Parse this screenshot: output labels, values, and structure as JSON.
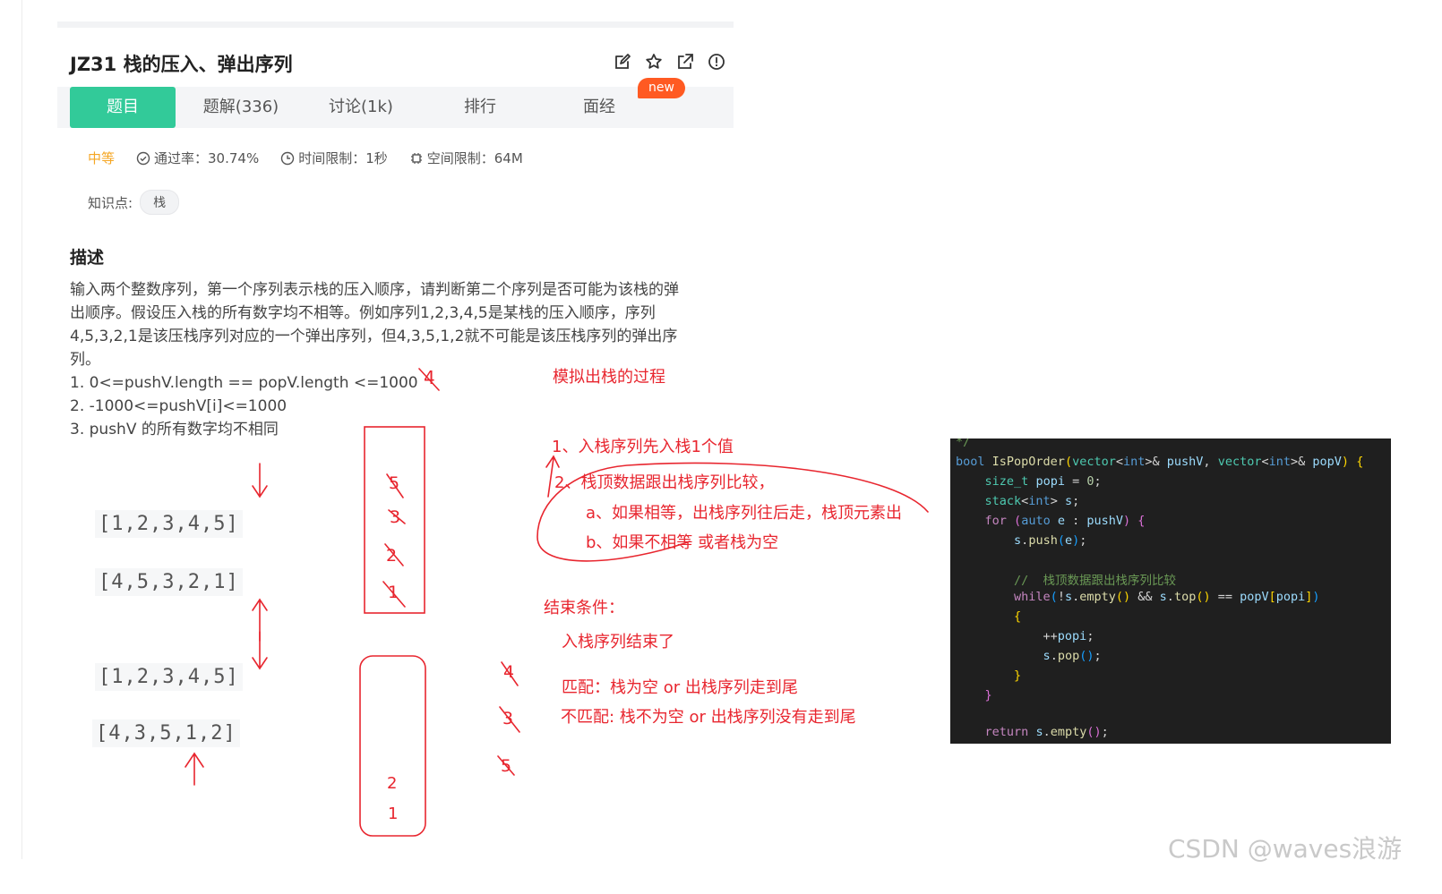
{
  "problem": {
    "title": "JZ31  栈的压入、弹出序列",
    "actions": [
      "edit-icon",
      "star-icon",
      "share-icon",
      "report-icon"
    ]
  },
  "tabs": [
    {
      "label": "题目",
      "active": true
    },
    {
      "label": "题解(336)",
      "active": false
    },
    {
      "label": "讨论(1k)",
      "active": false
    },
    {
      "label": "排行",
      "active": false
    },
    {
      "label": "面经",
      "active": false
    }
  ],
  "new_badge": "new",
  "meta": {
    "difficulty": "中等",
    "pass_rate": "通过率：30.74%",
    "time_limit": "时间限制：1秒",
    "space_limit": "空间限制：64M"
  },
  "knowledge": {
    "label": "知识点:",
    "tag": "栈"
  },
  "description": {
    "heading": "描述",
    "paragraph_lines": [
      "输入两个整数序列，第一个序列表示栈的压入顺序，请判断第二个序列是否可能为该栈的弹",
      "出顺序。假设压入栈的所有数字均不相等。例如序列1,2,3,4,5是某栈的压入顺序，序列",
      "4,5,3,2,1是该压栈序列对应的一个弹出序列，但4,3,5,1,2就不可能是该压栈序列的弹出序",
      "列。"
    ],
    "constraints": [
      "1. 0<=pushV.length == popV.length <=1000",
      "2. -1000<=pushV[i]<=1000",
      "3. pushV 的所有数字均不相同"
    ]
  },
  "sequences": {
    "push_a": "[1,2,3,4,5]",
    "pop_a": "[4,5,3,2,1]",
    "push_b": "[1,2,3,4,5]",
    "pop_b": "[4,3,5,1,2]"
  },
  "annotations": {
    "top_mark": "4",
    "stack_a": [
      "5",
      "3",
      "2",
      "1"
    ],
    "stack_b": [
      "2",
      "1"
    ],
    "side_marks": [
      "4",
      "3",
      "5"
    ],
    "heading": "模拟出栈的过程",
    "step1": "1、入栈序列先入栈1个值",
    "step2": "2、栈顶数据跟出栈序列比较，",
    "step2a": "a、如果相等，出栈序列往后走，栈顶元素出",
    "step2b": "b、如果不相等 或者栈为空",
    "end_title": "结束条件：",
    "end_line1": "入栈序列结束了",
    "match": "匹配：栈为空   or   出栈序列走到尾",
    "mismatch": "不匹配: 栈不为空   or   出栈序列没有走到尾"
  },
  "code": {
    "line1": {
      "kw": "bool",
      "fn": "IsPopOrder",
      "ty1": "vector",
      "ty1b": "int",
      "p1": "pushV",
      "ty2": "vector",
      "ty2b": "int",
      "p2": "popV"
    },
    "line2": {
      "ty": "size_t",
      "var": "popi",
      "num": "0"
    },
    "line3": {
      "ty": "stack",
      "tyb": "int",
      "var": "s"
    },
    "line4": {
      "kw": "for",
      "kw2": "auto",
      "var": "e",
      "var2": "pushV"
    },
    "line5": {
      "var": "s",
      "fn": "push",
      "arg": "e"
    },
    "comment": "//  栈顶数据跟出栈序列比较",
    "line7": {
      "kw": "while",
      "var": "s",
      "fn": "empty",
      "var2": "s",
      "fn2": "top",
      "var3": "popV",
      "var4": "popi"
    },
    "line9": {
      "var": "popi"
    },
    "line10": {
      "var": "s",
      "fn": "pop"
    },
    "line13": {
      "kw": "return",
      "var": "s",
      "fn": "empty"
    }
  },
  "watermark": "CSDN @waves浪游"
}
